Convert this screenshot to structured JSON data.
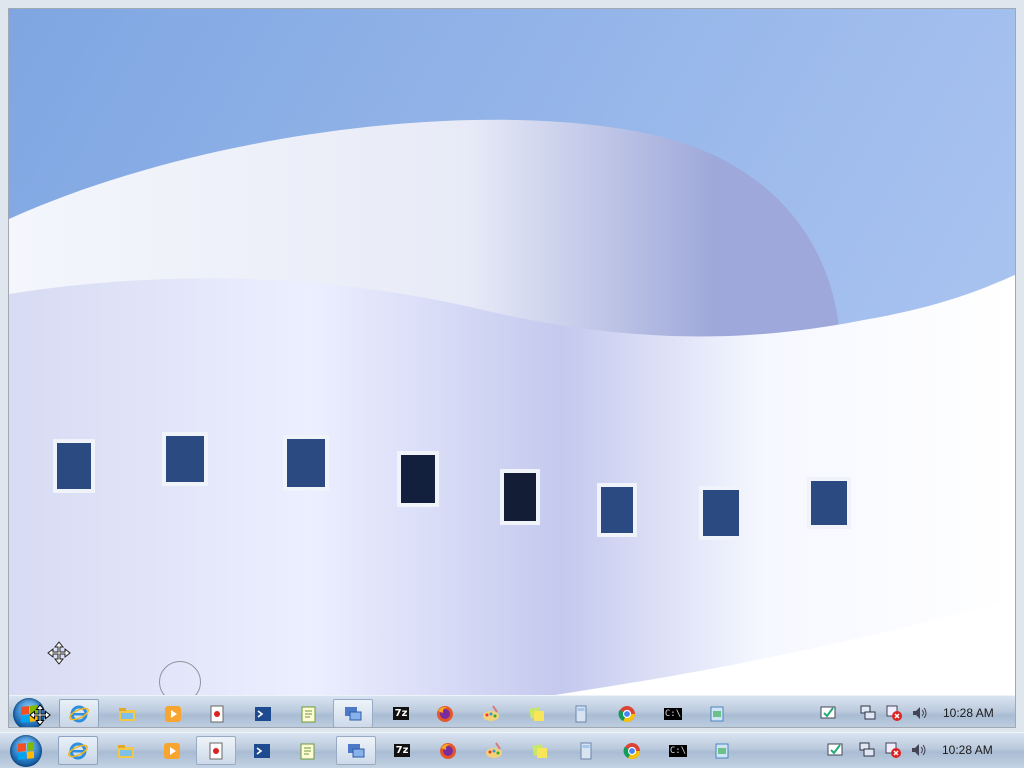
{
  "taskbar": {
    "apps": [
      {
        "name": "internet-explorer",
        "icon": "ie-icon"
      },
      {
        "name": "windows-explorer",
        "icon": "folder-icon"
      },
      {
        "name": "media-player",
        "icon": "media-player-icon"
      },
      {
        "name": "solitaire",
        "icon": "cards-icon"
      },
      {
        "name": "powershell",
        "icon": "powershell-icon"
      },
      {
        "name": "notepad",
        "icon": "notepad-icon"
      },
      {
        "name": "remote-desktop",
        "icon": "remote-desktop-icon"
      },
      {
        "name": "7-zip",
        "icon": "sevenzip-icon",
        "label": "7z"
      },
      {
        "name": "firefox",
        "icon": "firefox-icon"
      },
      {
        "name": "paint",
        "icon": "paint-icon"
      },
      {
        "name": "sticky-notes",
        "icon": "sticky-notes-icon"
      },
      {
        "name": "calculator",
        "icon": "calculator-icon"
      },
      {
        "name": "chrome",
        "icon": "chrome-icon"
      },
      {
        "name": "command-prompt",
        "icon": "cmd-icon",
        "label": "C:\\"
      },
      {
        "name": "file-manager",
        "icon": "file-manager-icon"
      }
    ],
    "tray": [
      "action-center-icon",
      "network-icon",
      "error-icon",
      "volume-icon"
    ],
    "clock": "10:28 AM"
  },
  "colors": {
    "sky": "#8fb0e6",
    "building": "#e6eaf6",
    "accent": "#1f6fb8"
  }
}
